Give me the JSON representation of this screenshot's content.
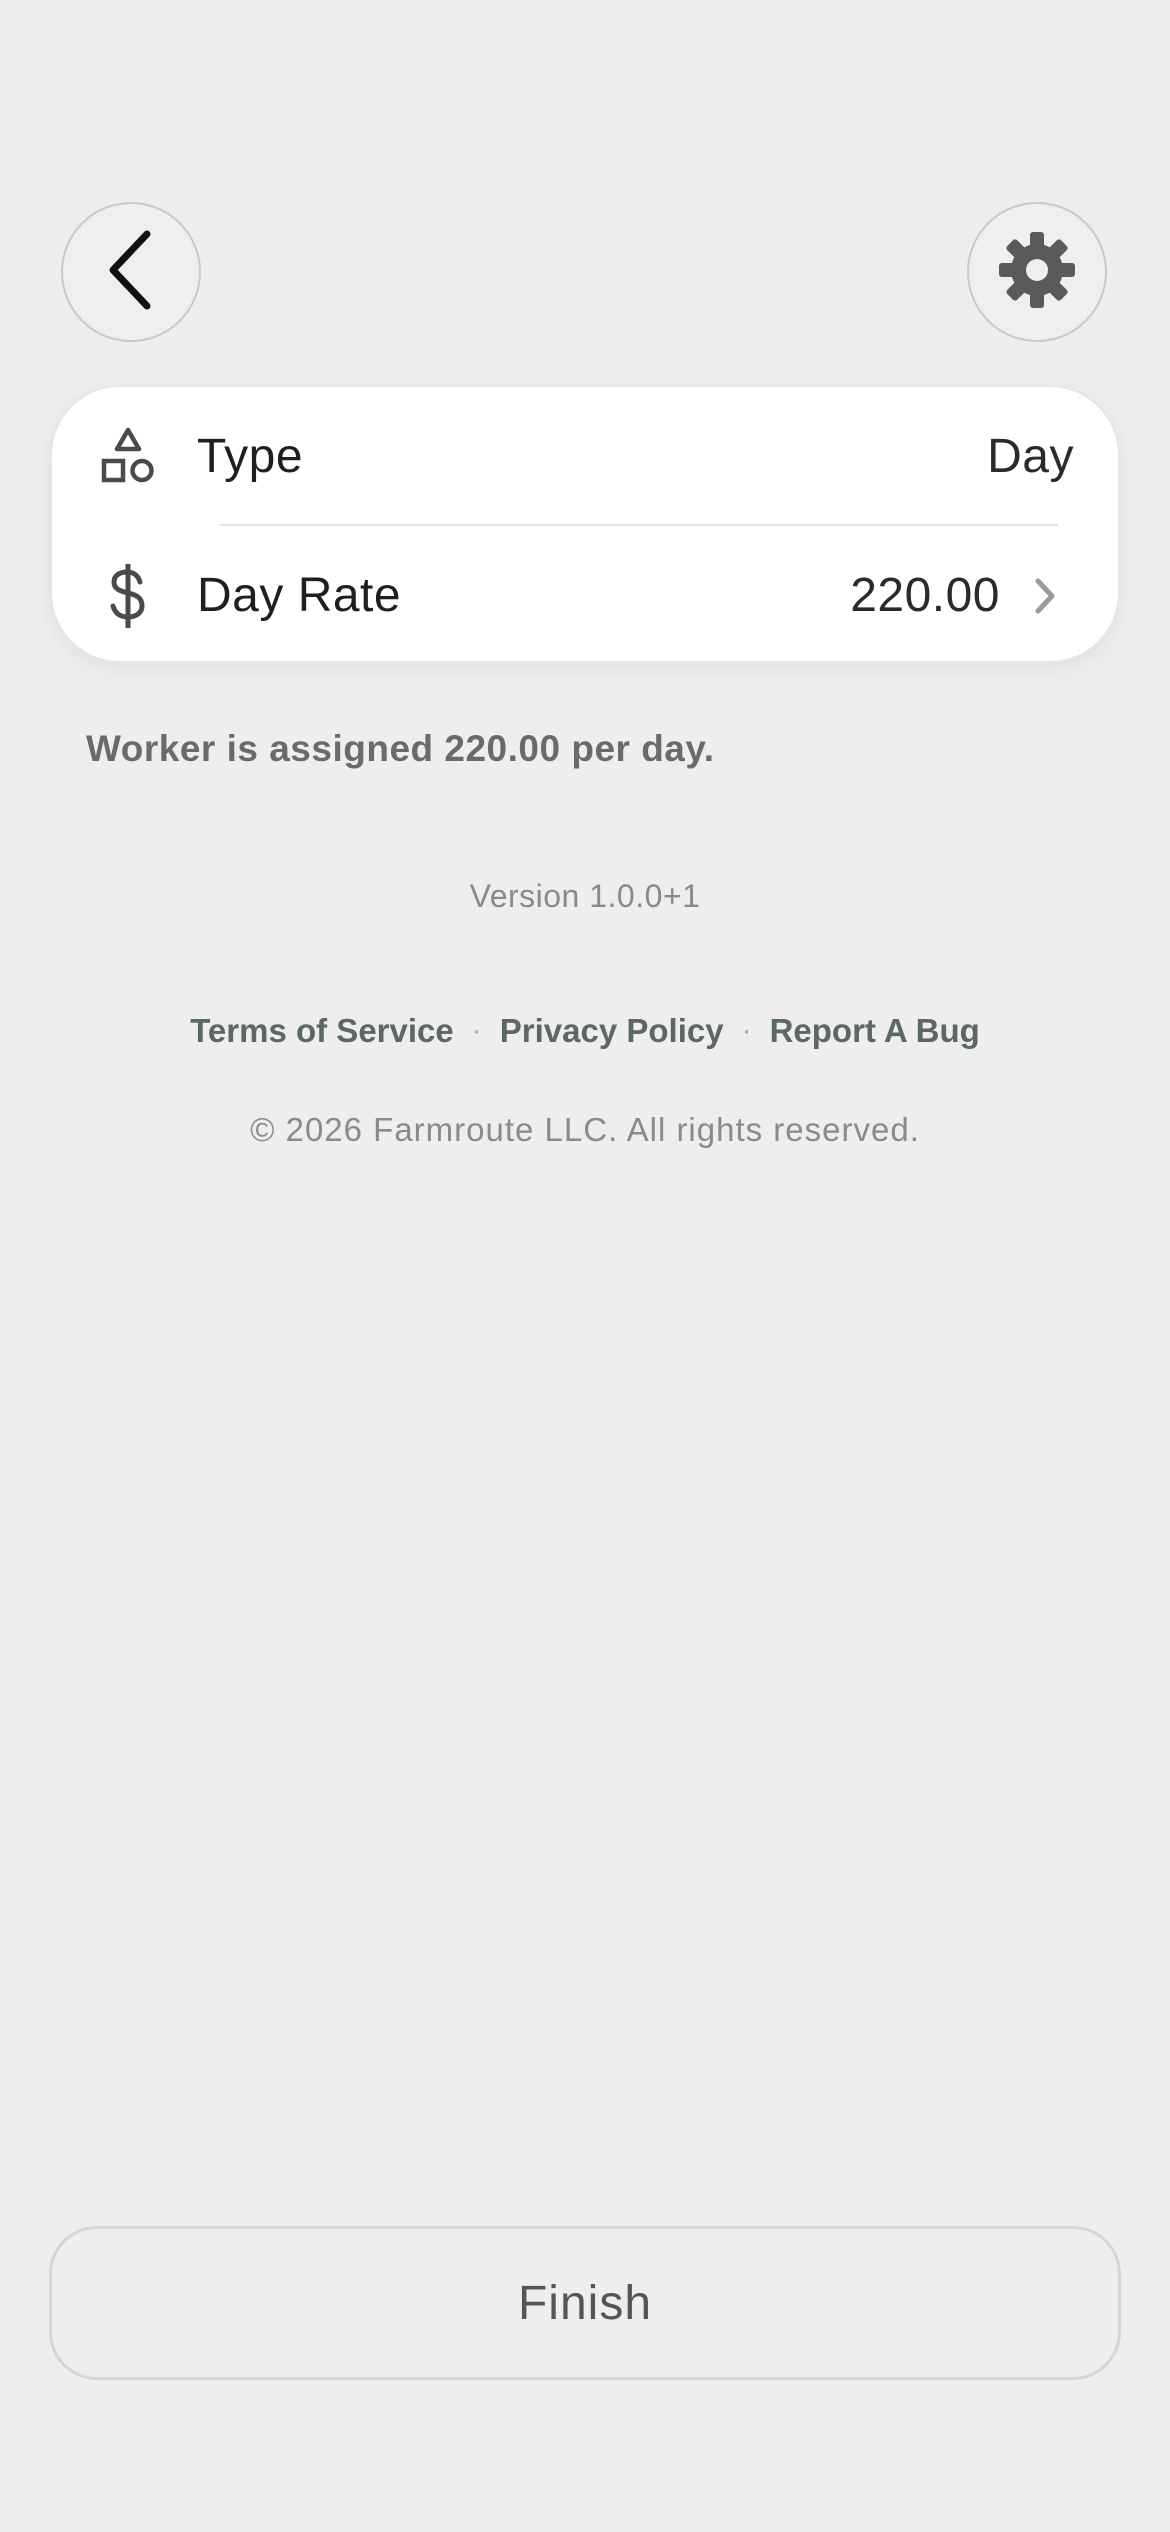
{
  "header": {
    "back_icon": "chevron-left-icon",
    "settings_icon": "gear-icon"
  },
  "card": {
    "type_row": {
      "icon": "shapes-icon",
      "label": "Type",
      "value": "Day"
    },
    "rate_row": {
      "icon": "dollar-icon",
      "label": "Day Rate",
      "value": "220.00",
      "chevron_icon": "chevron-right-icon"
    }
  },
  "info": {
    "text": "Worker is assigned 220.00 per day."
  },
  "footer": {
    "version": "Version 1.0.0+1",
    "links": {
      "terms": "Terms of Service",
      "privacy": "Privacy Policy",
      "report_bug": "Report A Bug",
      "separator": "·"
    },
    "copyright": "© 2026 Farmroute LLC. All rights reserved."
  },
  "actions": {
    "finish_label": "Finish"
  },
  "colors": {
    "background": "#eeeeee",
    "card": "#ffffff",
    "link": "#5b6864",
    "muted_text": "#8a8a8a"
  }
}
